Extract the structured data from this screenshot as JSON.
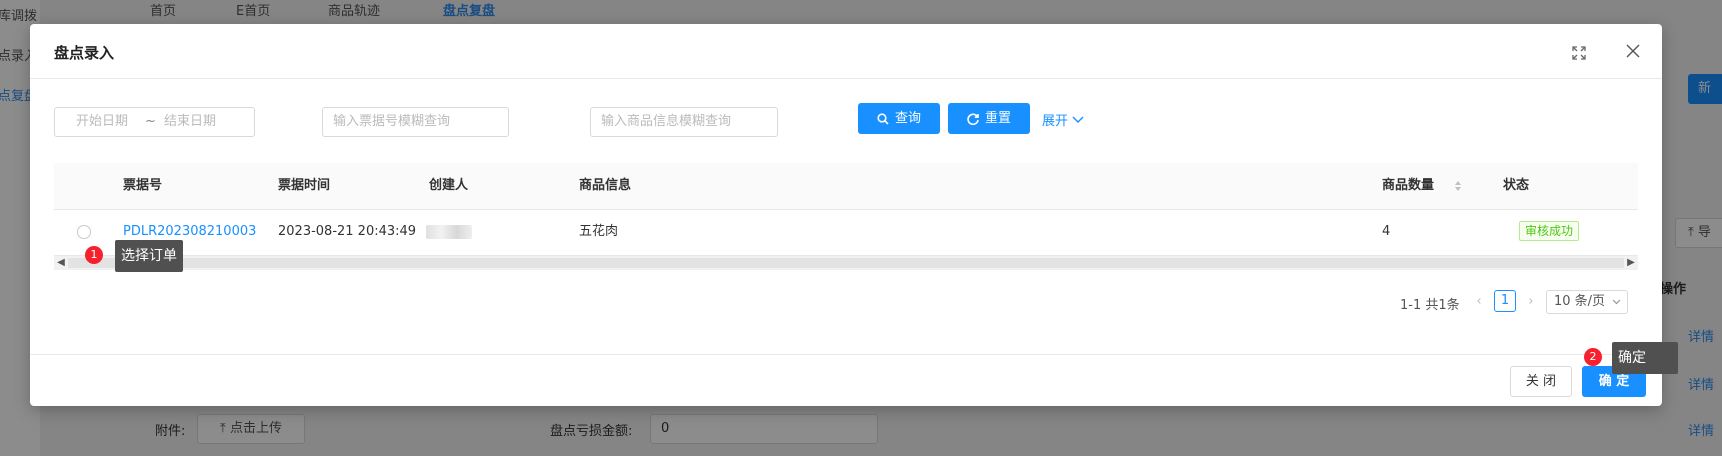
{
  "background": {
    "sidebar_items": [
      "库调拨",
      "点录入",
      "点复盘"
    ],
    "tabs": [
      "首页",
      "E首页",
      "商品轨迹",
      "盘点复盘"
    ],
    "new_button": "新",
    "export_button": "导",
    "ops_header": "操作",
    "row_links": [
      "详情",
      "详情",
      "详情"
    ],
    "attachment_label": "附件:",
    "upload_button": "点击上传",
    "loss_amount_label": "盘点亏损金额:",
    "loss_amount_value": "0"
  },
  "modal": {
    "title": "盘点录入",
    "filters": {
      "start_date_placeholder": "开始日期",
      "date_separator": "~",
      "end_date_placeholder": "结束日期",
      "ticket_placeholder": "输入票据号模糊查询",
      "goods_placeholder": "输入商品信息模糊查询",
      "query_button": "查询",
      "reset_button": "重置",
      "expand_link": "展开"
    },
    "table": {
      "columns": [
        "票据号",
        "票据时间",
        "创建人",
        "商品信息",
        "商品数量",
        "状态"
      ],
      "rows": [
        {
          "ticket_no": "PDLR202308210003",
          "ticket_time": "2023-08-21 20:43:49",
          "creator": "",
          "goods_info": "五花肉",
          "quantity": "4",
          "status": "审核成功"
        }
      ]
    },
    "pagination": {
      "total": "1-1 共1条",
      "current_page": "1",
      "page_size": "10 条/页"
    },
    "footer": {
      "close_button": "关 闭",
      "confirm_button": "确 定"
    }
  },
  "tour_hints": [
    {
      "number": "1",
      "text": "选择订单"
    },
    {
      "number": "2",
      "text": "确定"
    }
  ],
  "colors": {
    "primary": "#1890ff",
    "success": "#52c41a",
    "hint_badge": "#f5222d",
    "hint_box": "#505050"
  }
}
